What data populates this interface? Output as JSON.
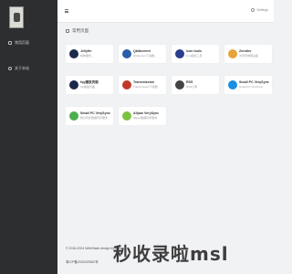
{
  "sidebar": {
    "items": [
      {
        "label": "常用页面",
        "icon": "star-icon"
      },
      {
        "label": "关于本站",
        "icon": "info-icon"
      }
    ]
  },
  "topbar": {
    "settings_label": "Settings"
  },
  "section": {
    "title": "常用页面"
  },
  "cards": [
    {
      "name": "Jellyfin",
      "desc": "媒体服务...",
      "color": "#1b2a4a"
    },
    {
      "name": "Qbittorrent",
      "desc": "Qbittorrent下载器...",
      "color": "#2a5ea8"
    },
    {
      "name": "icon tools",
      "desc": "icon图标工具",
      "color": "#2a3e8c"
    },
    {
      "name": "Zerotier",
      "desc": "访问局域网设备",
      "color": "#e8a33a"
    },
    {
      "name": "fqy播放页面",
      "desc": "fqy播放页面",
      "color": "#1b2a4a"
    },
    {
      "name": "Transmission",
      "desc": "Transmission下载器",
      "color": "#c0392b"
    },
    {
      "name": "RSS",
      "desc": "RSS订阅",
      "color": "#444444"
    },
    {
      "name": "Small PC VerySync",
      "desc": "Small PC VerySync",
      "color": "#1a8fe3"
    },
    {
      "name": "Small PC VerySync",
      "desc": "微力同步数据同步服务",
      "color": "#4caf50"
    },
    {
      "name": "Allpan VerySync",
      "desc": "Allpan数据同步服务",
      "color": "#7cc242"
    }
  ],
  "footer": {
    "copyright": "© 2016-2024 WebStack  design by Sahu",
    "icp": "粤ICP备2024023362号"
  },
  "watermark": "秒收录啦msl"
}
